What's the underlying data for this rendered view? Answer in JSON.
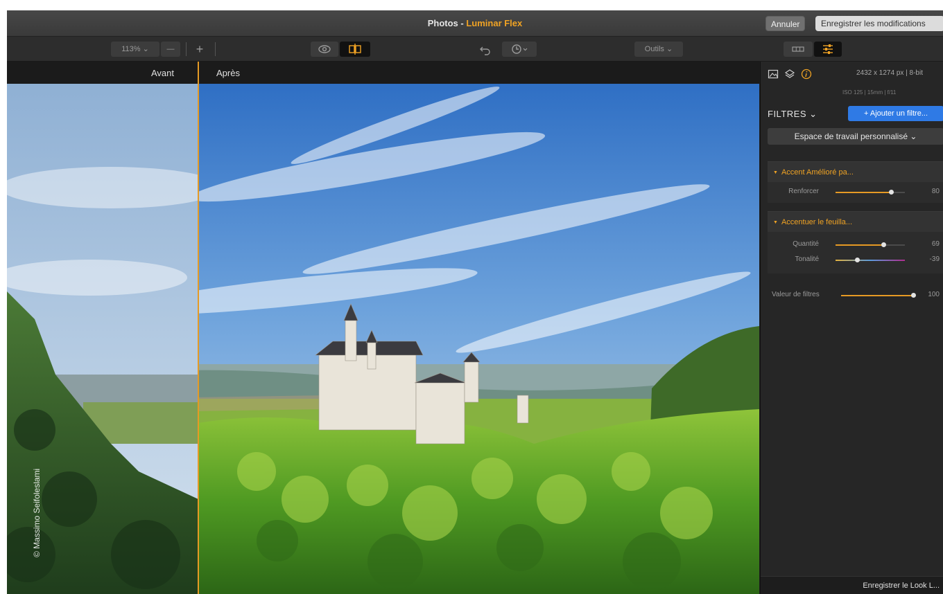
{
  "titlebar": {
    "title_prefix": "Photos - ",
    "title_app": "Luminar Flex",
    "cancel_label": "Annuler",
    "save_label": "Enregistrer les modifications"
  },
  "toolbar": {
    "zoom_level": "113%",
    "zoom_caret": "⌄",
    "zoom_out": "—",
    "zoom_in": "+",
    "tools_label": "Outils ⌄"
  },
  "compare": {
    "before_label": "Avant",
    "after_label": "Après"
  },
  "photo": {
    "credit": "© Massimo Seifoleslami"
  },
  "panel": {
    "dimensions": "2432 x 1274 px | 8-bit",
    "exif": "ISO 125 | 15mm | f/11",
    "filters_heading": "FILTRES ⌄",
    "add_filter_label": "+ Ajouter un filtre...",
    "workspace_label": "Espace de travail personnalisé ⌄",
    "filters": [
      {
        "name": "Accent Amélioré pa...",
        "sliders": [
          {
            "label": "Renforcer",
            "value": "80",
            "fraction": 0.8
          }
        ]
      },
      {
        "name": "Accentuer le feuilla...",
        "sliders": [
          {
            "label": "Quantité",
            "value": "69",
            "fraction": 0.69
          },
          {
            "label": "Tonalité",
            "value": "-39",
            "fraction": 0.305
          }
        ]
      }
    ],
    "global": {
      "label": "Valeur de filtres",
      "value": "100",
      "fraction": 1.0
    },
    "save_look_label": "Enregistrer le Look L..."
  },
  "colors": {
    "accent": "#e69a24",
    "title_app": "#f0a324",
    "add_filter": "#2f7ae5"
  }
}
